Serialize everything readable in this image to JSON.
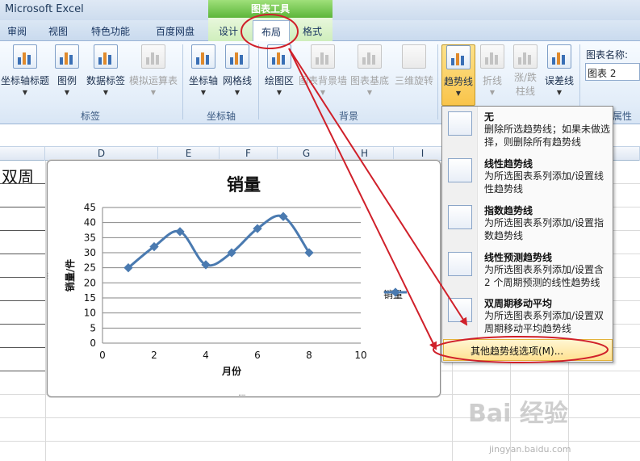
{
  "app": {
    "title": "Microsoft Excel"
  },
  "ribbon_tabs": {
    "context_header": "图表工具",
    "tabs": [
      "审阅",
      "视图",
      "特色功能",
      "百度网盘",
      "设计",
      "布局",
      "格式"
    ],
    "active": "布局"
  },
  "ribbon": {
    "groups": {
      "labels": "标签",
      "axes": "坐标轴",
      "background": "背景",
      "properties": "属性"
    },
    "buttons": {
      "axis_title": "坐标轴标题",
      "legend": "图例",
      "data_labels": "数据标签",
      "data_table": "模拟运算表",
      "axes": "坐标轴",
      "gridlines": "网格线",
      "plot_area": "绘图区",
      "chart_wall": "图表背景墙",
      "chart_floor": "图表基底",
      "rotation_3d": "三维旋转",
      "trendline": "趋势线",
      "lines": "折线",
      "up_down_bars_1": "涨/跌",
      "up_down_bars_2": "柱线",
      "error_bars": "误差线"
    },
    "chart_name_label": "图表名称:",
    "chart_name_value": "图表 2"
  },
  "sheet": {
    "columns": [
      "D",
      "E",
      "F",
      "G",
      "H",
      "I"
    ],
    "cell_text": "双周"
  },
  "chart_data": {
    "type": "line",
    "title": "销量",
    "xlabel": "月份",
    "ylabel": "销量/件",
    "xlim": [
      0,
      10
    ],
    "ylim": [
      0,
      45
    ],
    "x_ticks": [
      0,
      2,
      4,
      6,
      8,
      10
    ],
    "y_ticks": [
      0,
      5,
      10,
      15,
      20,
      25,
      30,
      35,
      40,
      45
    ],
    "series": [
      {
        "name": "销量",
        "x": [
          1,
          2,
          3,
          4,
          5,
          6,
          7,
          8
        ],
        "y": [
          25,
          32,
          37,
          26,
          30,
          38,
          42,
          30
        ]
      }
    ],
    "smooth": true,
    "grid": "horizontal",
    "legend_position": "right",
    "series_color": "#4a7ab0"
  },
  "trend_menu": {
    "items": [
      {
        "title": "无",
        "desc": "删除所选趋势线；如果未做选择，则删除所有趋势线"
      },
      {
        "title": "线性趋势线",
        "desc": "为所选图表系列添加/设置线性趋势线"
      },
      {
        "title": "指数趋势线",
        "desc": "为所选图表系列添加/设置指数趋势线"
      },
      {
        "title": "线性预测趋势线",
        "desc": "为所选图表系列添加/设置含 2 个周期预测的线性趋势线"
      },
      {
        "title": "双周期移动平均",
        "desc": "为所选图表系列添加/设置双周期移动平均趋势线"
      }
    ],
    "more_options": "其他趋势线选项(M)..."
  },
  "watermark": {
    "main": "Bai 经验",
    "sub": "jingyan.baidu.com"
  },
  "colors": {
    "annotation": "#d0202a",
    "ribbon_highlight": "#f9c44a",
    "context_green": "#5cb53a"
  }
}
